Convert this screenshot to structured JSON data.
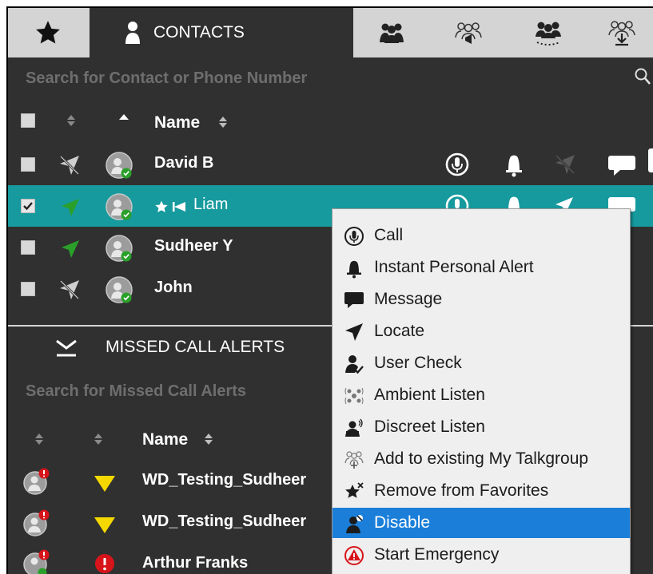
{
  "tabs": {
    "contacts_label": "CONTACTS"
  },
  "search": {
    "contacts_placeholder": "Search for Contact or Phone Number",
    "missed_placeholder": "Search for Missed Call Alerts"
  },
  "columns": {
    "name": "Name"
  },
  "contacts": [
    {
      "name": "David B",
      "selected": false,
      "status": "offline"
    },
    {
      "name": "Liam",
      "selected": true,
      "status": "online",
      "favorite": true
    },
    {
      "name": "Sudheer Y",
      "selected": false,
      "status": "online"
    },
    {
      "name": "John",
      "selected": false,
      "status": "offline"
    }
  ],
  "missed": {
    "title": "MISSED CALL ALERTS",
    "rows": [
      {
        "name": "WD_Testing_Sudheer",
        "priority": "warning"
      },
      {
        "name": "WD_Testing_Sudheer",
        "priority": "warning"
      },
      {
        "name": "Arthur Franks",
        "priority": "emergency"
      }
    ]
  },
  "context_menu": {
    "items": [
      {
        "label": "Call",
        "icon": "call-icon"
      },
      {
        "label": "Instant Personal Alert",
        "icon": "bell-icon"
      },
      {
        "label": "Message",
        "icon": "message-icon"
      },
      {
        "label": "Locate",
        "icon": "locate-icon"
      },
      {
        "label": "User Check",
        "icon": "user-check-icon"
      },
      {
        "label": "Ambient Listen",
        "icon": "ambient-listen-icon"
      },
      {
        "label": "Discreet Listen",
        "icon": "discreet-listen-icon"
      },
      {
        "label": "Add to existing My Talkgroup",
        "icon": "add-talkgroup-icon"
      },
      {
        "label": "Remove from Favorites",
        "icon": "remove-favorite-icon"
      },
      {
        "label": "Disable",
        "icon": "disable-icon"
      },
      {
        "label": "Start Emergency",
        "icon": "emergency-icon"
      }
    ],
    "highlighted": "Disable"
  },
  "colors": {
    "background": "#303030",
    "tabbar": "#d4d4d4",
    "selected_row": "#169a9e",
    "menu_highlight": "#1b7fd9",
    "online_green": "#2aa02a",
    "warning_yellow": "#f5d800",
    "emergency_red": "#d7141a"
  }
}
